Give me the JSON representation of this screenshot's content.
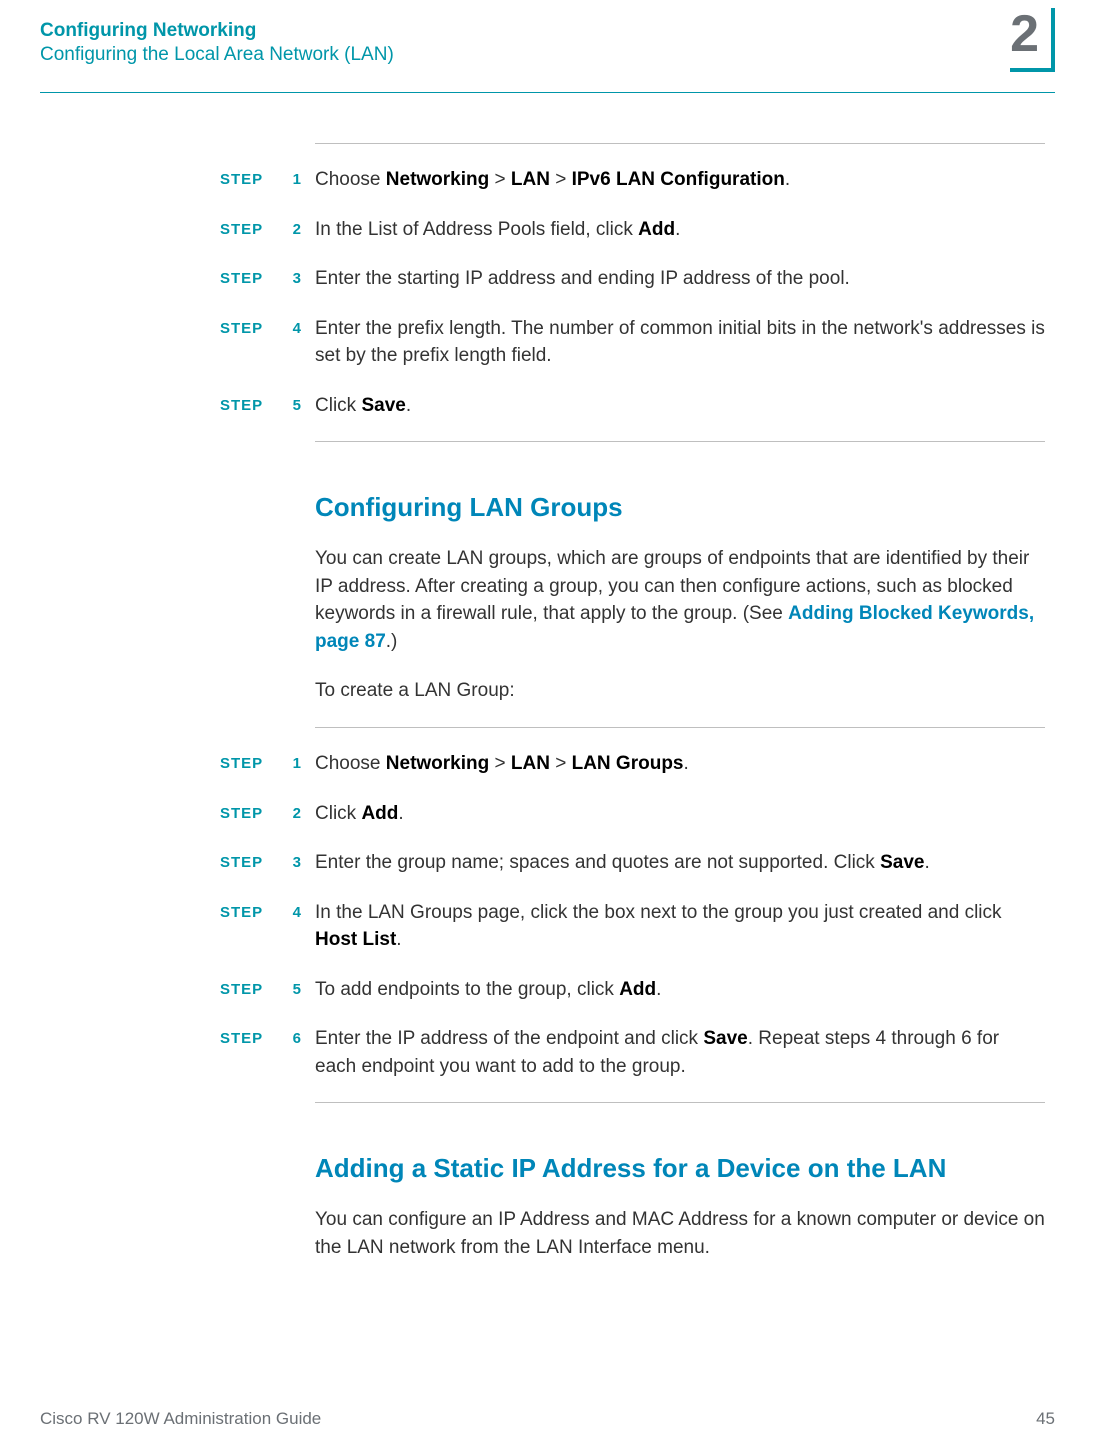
{
  "header": {
    "chapter_title": "Configuring Networking",
    "section_title": "Configuring the Local Area Network (LAN)",
    "chapter_number": "2"
  },
  "steps_a_label": "STEP",
  "steps_a": [
    {
      "n": "1",
      "parts": [
        "Choose ",
        {
          "b": "Networking"
        },
        " > ",
        {
          "b": "LAN"
        },
        " > ",
        {
          "b": "IPv6 LAN Configuration"
        },
        "."
      ]
    },
    {
      "n": "2",
      "parts": [
        "In the List of Address Pools field, click ",
        {
          "b": "Add"
        },
        "."
      ]
    },
    {
      "n": "3",
      "parts": [
        "Enter the starting IP address and ending IP address of the pool."
      ]
    },
    {
      "n": "4",
      "parts": [
        "Enter the prefix length. The number of common initial bits in the network's addresses is set by the prefix length field."
      ]
    },
    {
      "n": "5",
      "parts": [
        "Click ",
        {
          "b": "Save"
        },
        "."
      ]
    }
  ],
  "section1": {
    "heading": "Configuring LAN Groups",
    "para1_parts": [
      "You can create LAN groups, which are groups of endpoints that are identified by their IP address. After creating a group, you can then configure actions, such as blocked keywords in a firewall rule, that apply to the group. (See ",
      {
        "link": "Adding Blocked Keywords, page 87"
      },
      ".)"
    ],
    "para2": "To create a LAN Group:"
  },
  "steps_b_label": "STEP",
  "steps_b": [
    {
      "n": "1",
      "parts": [
        "Choose ",
        {
          "b": "Networking"
        },
        " > ",
        {
          "b": "LAN"
        },
        " > ",
        {
          "b": "LAN Groups"
        },
        "."
      ]
    },
    {
      "n": "2",
      "parts": [
        "Click ",
        {
          "b": "Add"
        },
        "."
      ]
    },
    {
      "n": "3",
      "parts": [
        "Enter the group name; spaces and quotes are not supported. Click ",
        {
          "b": "Save"
        },
        "."
      ]
    },
    {
      "n": "4",
      "parts": [
        "In the LAN Groups page, click the box next to the group you just created and click ",
        {
          "b": "Host List"
        },
        "."
      ]
    },
    {
      "n": "5",
      "parts": [
        "To add endpoints to the group, click ",
        {
          "b": "Add"
        },
        "."
      ]
    },
    {
      "n": "6",
      "parts": [
        "Enter the IP address of the endpoint and click ",
        {
          "b": "Save"
        },
        ". Repeat steps 4 through 6 for each endpoint you want to add to the group."
      ]
    }
  ],
  "section2": {
    "heading": "Adding a Static IP Address for a Device on the LAN",
    "para1": "You can configure an IP Address and MAC Address for a known computer or device on the LAN network from the LAN Interface menu."
  },
  "footer": {
    "left": "Cisco RV 120W Administration Guide",
    "right": "45"
  }
}
